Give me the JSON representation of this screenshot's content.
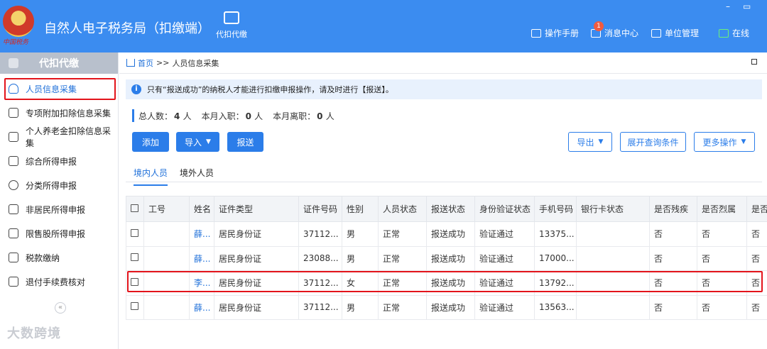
{
  "header": {
    "title": "自然人电子税务局（扣缴端）",
    "nav_button": "代扣代缴",
    "tools": [
      "操作手册",
      "消息中心",
      "单位管理",
      "在线"
    ],
    "message_badge": "1",
    "window_controls": [
      "–",
      "▭"
    ]
  },
  "sidebar": {
    "title": "代扣代缴",
    "items": [
      {
        "label": "人员信息采集",
        "icon": "person-icon"
      },
      {
        "label": "专项附加扣除信息采集",
        "icon": "list-icon"
      },
      {
        "label": "个人养老金扣除信息采集",
        "icon": "document-icon"
      },
      {
        "label": "综合所得申报",
        "icon": "layers-icon"
      },
      {
        "label": "分类所得申报",
        "icon": "pie-icon"
      },
      {
        "label": "非居民所得申报",
        "icon": "person-outline-icon"
      },
      {
        "label": "限售股所得申报",
        "icon": "bar-chart-icon"
      },
      {
        "label": "税款缴纳",
        "icon": "wallet-icon"
      },
      {
        "label": "退付手续费核对",
        "icon": "receipt-icon"
      }
    ],
    "collapse_label": "«",
    "watermark": "大数跨境"
  },
  "breadcrumb": {
    "home": "首页",
    "sep": ">>",
    "current": "人员信息采集"
  },
  "notice": {
    "icon": "i",
    "text": "只有“报送成功”的纳税人才能进行扣缴申报操作，请及时进行【报送】。"
  },
  "stats": {
    "total_label": "总人数：",
    "total": "4",
    "total_unit": "人",
    "joined_label": "本月入职：",
    "joined": "0",
    "joined_unit": "人",
    "left_label": "本月离职：",
    "left": "0",
    "left_unit": "人"
  },
  "actions": {
    "add": "添加",
    "import": "导入",
    "submit": "报送",
    "export": "导出",
    "expand_query": "展开查询条件",
    "more": "更多操作"
  },
  "tabs": [
    "境内人员",
    "境外人员"
  ],
  "table": {
    "columns": [
      "工号",
      "姓名",
      "证件类型",
      "证件号码",
      "性别",
      "人员状态",
      "报送状态",
      "身份验证状态",
      "手机号码",
      "银行卡状态",
      "是否残疾",
      "是否烈属",
      "是否"
    ],
    "rows": [
      {
        "id": "",
        "name": "薛...",
        "id_type": "居民身份证",
        "id_no": "37112...",
        "gender": "男",
        "status": "正常",
        "submit": "报送成功",
        "verify": "验证通过",
        "phone": "13375...",
        "bank": "",
        "disabled": "否",
        "martyr": "否",
        "extra": "否"
      },
      {
        "id": "",
        "name": "薛...",
        "id_type": "居民身份证",
        "id_no": "23088...",
        "gender": "男",
        "status": "正常",
        "submit": "报送成功",
        "verify": "验证通过",
        "phone": "17000...",
        "bank": "",
        "disabled": "否",
        "martyr": "否",
        "extra": "否"
      },
      {
        "id": "",
        "name": "李...",
        "id_type": "居民身份证",
        "id_no": "37112...",
        "gender": "女",
        "status": "正常",
        "submit": "报送成功",
        "verify": "验证通过",
        "phone": "13792...",
        "bank": "",
        "disabled": "否",
        "martyr": "否",
        "extra": "否"
      },
      {
        "id": "",
        "name": "薛...",
        "id_type": "居民身份证",
        "id_no": "37112...",
        "gender": "男",
        "status": "正常",
        "submit": "报送成功",
        "verify": "验证通过",
        "phone": "13563...",
        "bank": "",
        "disabled": "否",
        "martyr": "否",
        "extra": "否"
      }
    ]
  },
  "colors": {
    "header_bg": "#3b8cf0",
    "accent": "#2b7de9",
    "highlight": "#e3141b"
  }
}
